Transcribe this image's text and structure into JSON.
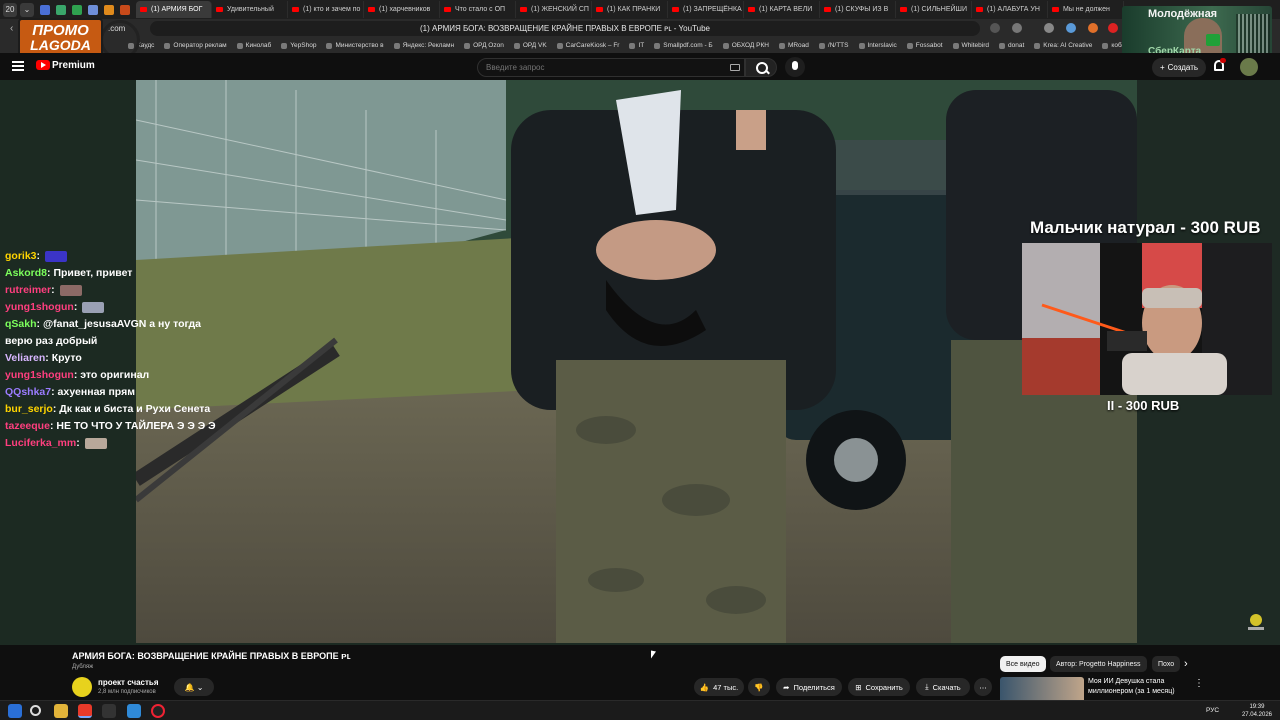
{
  "browser": {
    "tab_counter": "20",
    "tabs": [
      {
        "label": "(1) АРМИЯ БОГ",
        "active": true
      },
      {
        "label": "Удивительный",
        "active": false
      },
      {
        "label": "(1) кто и зачем по",
        "active": false
      },
      {
        "label": "(1) харчевников",
        "active": false
      },
      {
        "label": "Что стало с ОП",
        "active": false
      },
      {
        "label": "(1) ЖЕНСКИЙ СП",
        "active": false
      },
      {
        "label": "(1) КАК ПРАНКИ",
        "active": false
      },
      {
        "label": "(1) ЗАПРЕЩЁНКА",
        "active": false
      },
      {
        "label": "(1) КАРТА ВЕЛИ",
        "active": false
      },
      {
        "label": "(1) СКУФЫ ИЗ В",
        "active": false
      },
      {
        "label": "(1) СИЛЬНЕЙШИ",
        "active": false
      },
      {
        "label": "(1) АЛАБУГА УН",
        "active": false
      },
      {
        "label": "Мы не должен",
        "active": false
      }
    ],
    "page_title": "(1) АРМИЯ БОГА: ВОЗВРАЩЕНИЕ КРАЙНЕ ПРАВЫХ В ЕВРОПЕ ᴘʟ - YouTube",
    "bookmarks": [
      "Каудс",
      "Оператор реклам",
      "Кинолаб",
      "YepShop",
      "Министерство в",
      "Яндекс: Рекламн",
      "ОРД Ozon",
      "ОРД VK",
      "CarCareKiosk – Fr",
      "IT",
      "Smallpdf.com - Б",
      "ОБХОД РКН",
      "MRoad",
      "/N/TTS",
      "Interslavic",
      "Fossabot",
      "Whitebird",
      "donat",
      "Krea: AI Creative",
      "кобальт"
    ]
  },
  "promo_overlay": {
    "line1": "ПРОМО",
    "line2": "LAGODA",
    "suffix": ".com"
  },
  "sber_ad": {
    "line1": "Молодёжная",
    "line2": "СберКарта"
  },
  "youtube": {
    "logo_text": "Premium",
    "search_placeholder": "Введите запрос",
    "create_label": "Создать",
    "notifications_badge": "9+"
  },
  "chat": [
    {
      "user": "gorik3",
      "color": "#ffd400",
      "text": "",
      "emote": "#3b34c7"
    },
    {
      "user": "Askord8",
      "color": "#7cff5c",
      "text": "Привет, привет",
      "emote": ""
    },
    {
      "user": "rutreimer",
      "color": "#ff3f7f",
      "text": "",
      "emote": "#8c6a66"
    },
    {
      "user": "yung1shogun",
      "color": "#ff3f7f",
      "text": "",
      "emote": "#9aa0b4"
    },
    {
      "user": "qSakh",
      "color": "#7cff5c",
      "text": "@fanat_jesusaAVGN а ну тогда верю раз добрый",
      "emote": ""
    },
    {
      "user": "Veliaren",
      "color": "#d8b6ff",
      "text": "Круто",
      "emote": ""
    },
    {
      "user": "yung1shogun",
      "color": "#ff3f7f",
      "text": "это оригинал",
      "emote": ""
    },
    {
      "user": "QQshka7",
      "color": "#9b7cff",
      "text": "ахуенная прям",
      "emote": ""
    },
    {
      "user": "bur_serjo",
      "color": "#ffd400",
      "text": "Дк как и биста и Рухи Сенета",
      "emote": ""
    },
    {
      "user": "tazeeque",
      "color": "#ff3f7f",
      "text": "НЕ ТО ЧТО У ТАЙЛЕРА Э Э Э Э",
      "emote": ""
    },
    {
      "user": "Luciferka_mm",
      "color": "#ff3f7f",
      "text": "",
      "emote": "#b8a89a"
    }
  ],
  "stream_overlay": {
    "line1": "Мальчик натурал - 300 RUB",
    "line2": "II - 300 RUB"
  },
  "video": {
    "title": "АРМИЯ БОГА: ВОЗВРАЩЕНИЕ КРАЙНЕ ПРАВЫХ В ЕВРОПЕ ᴘʟ",
    "dubbed_label": "Дубляж",
    "channel": "проект счастья",
    "subscribers": "2,8 млн подписчиков",
    "likes": "47 тыс.",
    "share_label": "Поделиться",
    "save_label": "Сохранить",
    "download_label": "Скачать",
    "more_label": "⋯"
  },
  "recommendations": {
    "chips": [
      "Все видео",
      "Автор: Progetto Happiness",
      "Похо"
    ],
    "first_title": "Моя ИИ Девушка стала миллионером (за 1 месяц)"
  },
  "taskbar": {
    "lang": "РУС",
    "time": "19:39",
    "date": "27.04.2026"
  }
}
